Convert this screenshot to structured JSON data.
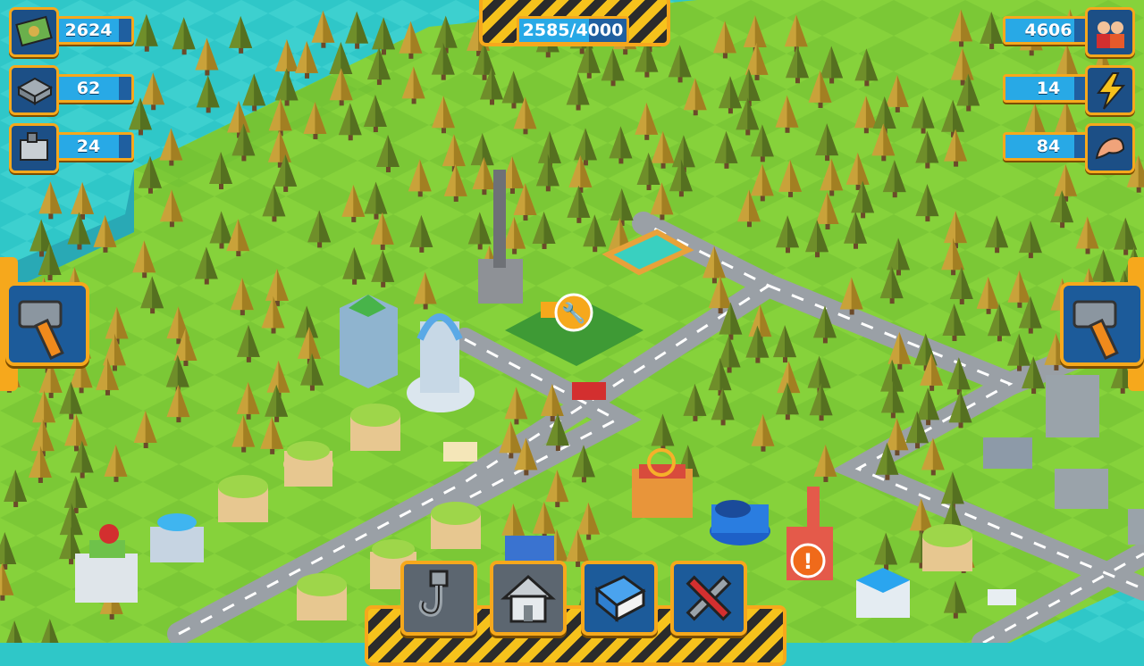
{
  "resources_left": [
    {
      "id": "money",
      "value": "2624",
      "fill": 0.85,
      "icon": "money-icon"
    },
    {
      "id": "steel",
      "value": "62",
      "fill": 0.85,
      "icon": "steel-icon"
    },
    {
      "id": "machine",
      "value": "24",
      "fill": 0.85,
      "icon": "machine-icon"
    }
  ],
  "resources_right": [
    {
      "id": "population",
      "value": "4606",
      "fill": 0.8,
      "icon": "population-icon"
    },
    {
      "id": "energy",
      "value": "14",
      "fill": 0.8,
      "icon": "lightning-icon"
    },
    {
      "id": "workforce",
      "value": "84",
      "fill": 0.8,
      "icon": "muscle-icon"
    }
  ],
  "progress": {
    "value": "2585/4000",
    "fraction": 0.646
  },
  "toolbar": {
    "items": [
      {
        "id": "crane",
        "icon": "crane-hook-icon"
      },
      {
        "id": "build",
        "icon": "house-icon"
      },
      {
        "id": "book",
        "icon": "book-icon"
      },
      {
        "id": "repair",
        "icon": "wrench-screwdriver-icon"
      }
    ]
  },
  "side_buttons": {
    "left": "hammer-icon",
    "right": "hammer-icon"
  },
  "colors": {
    "accent": "#f6a81c",
    "panel": "#1f5fa0",
    "fill": "#28a9e6",
    "water": "#2fc7c8",
    "grass": "#8ed63a"
  }
}
